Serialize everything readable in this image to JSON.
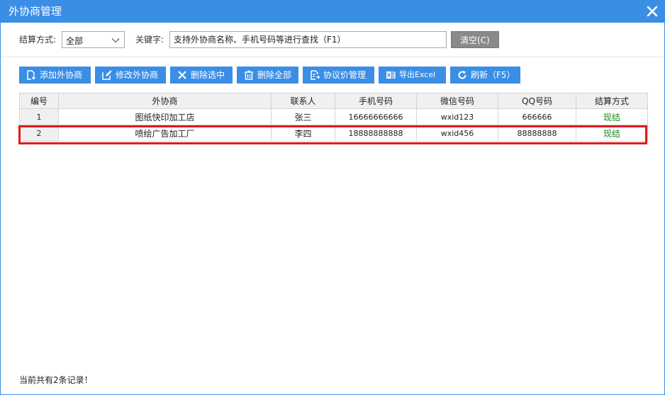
{
  "window": {
    "title": "外协商管理",
    "close_icon": "close-icon"
  },
  "filters": {
    "settlement_label": "结算方式:",
    "settlement_value": "全部",
    "keyword_label": "关键字:",
    "keyword_placeholder": "支持外协商名称、手机号码等进行查找（F1）",
    "keyword_value": "",
    "clear_label": "清空(C)"
  },
  "toolbar": {
    "add": "添加外协商",
    "edit": "修改外协商",
    "delete_selected": "删除选中",
    "delete_all": "删除全部",
    "agreed_price": "协议价管理",
    "export": "导出Excel",
    "refresh": "刷新（F5）"
  },
  "table": {
    "columns": [
      "编号",
      "外协商",
      "联系人",
      "手机号码",
      "微信号码",
      "QQ号码",
      "结算方式"
    ],
    "rows": [
      [
        "1",
        "图纸快印加工店",
        "张三",
        "16666666666",
        "wxid123",
        "666666",
        "现结"
      ],
      [
        "2",
        "喷绘广告加工厂",
        "李四",
        "18888888888",
        "wxid456",
        "88888888",
        "现结"
      ]
    ]
  },
  "footer": {
    "status": "当前共有2条记录！"
  },
  "colors": {
    "accent": "#3a8ee6",
    "highlight": "#e01b1b",
    "settlement_green": "#1a8a1a"
  }
}
